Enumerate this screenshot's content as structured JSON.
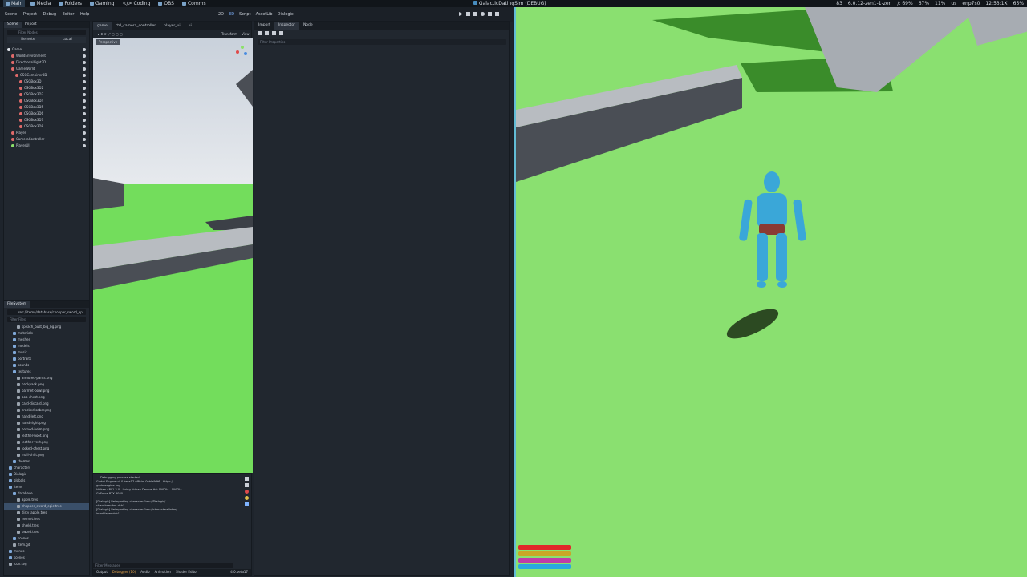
{
  "topbar": {
    "workspaces": [
      {
        "label": "Main",
        "active": true
      },
      {
        "label": "Media"
      },
      {
        "label": "Folders"
      },
      {
        "label": "Gaming"
      },
      {
        "label": "</> Coding"
      },
      {
        "label": "OBS"
      },
      {
        "label": "Comms"
      }
    ],
    "window_title": "GalacticDatingSim (DEBUG)",
    "status": [
      "83",
      "6.0.12-zen1-1-zen",
      "/: 69%",
      "67%",
      "11%",
      "us",
      "enp7s0",
      "12:53:1X",
      "65%"
    ]
  },
  "godot": {
    "menu": [
      "Scene",
      "Project",
      "Debug",
      "Editor",
      "Help"
    ],
    "main_screens": [
      "2D",
      "3D",
      "Script",
      "AssetLib",
      "Dialogic"
    ],
    "scene_dock": {
      "tabs": [
        "Scene",
        "Import"
      ],
      "filter_placeholder": "Filter Nodes",
      "buttons": [
        "Remote",
        "Local"
      ],
      "nodes": [
        {
          "name": "Game",
          "depth": 0,
          "color": "#e0e4ea"
        },
        {
          "name": "WorldEnvironment",
          "depth": 1,
          "color": "#e06a6a"
        },
        {
          "name": "DirectionalLight3D",
          "depth": 1,
          "color": "#e06a6a"
        },
        {
          "name": "GameWorld",
          "depth": 1,
          "color": "#e06a6a"
        },
        {
          "name": "CSGCombiner3D",
          "depth": 2,
          "color": "#e06a6a"
        },
        {
          "name": "CSGBox3D",
          "depth": 3,
          "color": "#e06a6a"
        },
        {
          "name": "CSGBox3D2",
          "depth": 3,
          "color": "#e06a6a"
        },
        {
          "name": "CSGBox3D3",
          "depth": 3,
          "color": "#e06a6a"
        },
        {
          "name": "CSGBox3D4",
          "depth": 3,
          "color": "#e06a6a"
        },
        {
          "name": "CSGBox3D5",
          "depth": 3,
          "color": "#e06a6a"
        },
        {
          "name": "CSGBox3D6",
          "depth": 3,
          "color": "#e06a6a"
        },
        {
          "name": "CSGBox3D7",
          "depth": 3,
          "color": "#e06a6a"
        },
        {
          "name": "CSGBox3D8",
          "depth": 3,
          "color": "#e06a6a"
        },
        {
          "name": "Player",
          "depth": 1,
          "color": "#e06a6a"
        },
        {
          "name": "CameraController",
          "depth": 1,
          "color": "#e06a6a"
        },
        {
          "name": "PlayerUI",
          "depth": 1,
          "color": "#8ce06a"
        }
      ]
    },
    "filesystem": {
      "tab": "FileSystem",
      "path": "res://items/database/chopper_sword_epi...",
      "filter_placeholder": "Filter Files",
      "files": [
        {
          "name": "speach_bust_big_bg.png",
          "depth": 2
        },
        {
          "name": "materials",
          "depth": 1,
          "folder": true
        },
        {
          "name": "meshes",
          "depth": 1,
          "folder": true
        },
        {
          "name": "models",
          "depth": 1,
          "folder": true
        },
        {
          "name": "music",
          "depth": 1,
          "folder": true
        },
        {
          "name": "portraits",
          "depth": 1,
          "folder": true
        },
        {
          "name": "sounds",
          "depth": 1,
          "folder": true
        },
        {
          "name": "textures",
          "depth": 1,
          "folder": true
        },
        {
          "name": "armored-pants.png",
          "depth": 2
        },
        {
          "name": "backpack.png",
          "depth": 2
        },
        {
          "name": "barrnet-bowl.png",
          "depth": 2
        },
        {
          "name": "bob-chest.png",
          "depth": 2
        },
        {
          "name": "card-discard.png",
          "depth": 2
        },
        {
          "name": "cracked-saber.png",
          "depth": 2
        },
        {
          "name": "hand-left.png",
          "depth": 2
        },
        {
          "name": "hand-right.png",
          "depth": 2
        },
        {
          "name": "horned-helm.png",
          "depth": 2
        },
        {
          "name": "leather-boot.png",
          "depth": 2
        },
        {
          "name": "leather-vest.png",
          "depth": 2
        },
        {
          "name": "locked-chest.png",
          "depth": 2
        },
        {
          "name": "mail-shirt.png",
          "depth": 2
        },
        {
          "name": "themes",
          "depth": 1,
          "folder": true
        },
        {
          "name": "characters",
          "depth": 0,
          "folder": true
        },
        {
          "name": "Dialogic",
          "depth": 0,
          "folder": true
        },
        {
          "name": "globals",
          "depth": 0,
          "folder": true
        },
        {
          "name": "items",
          "depth": 0,
          "folder": true
        },
        {
          "name": "database",
          "depth": 1,
          "folder": true
        },
        {
          "name": "apple.tres",
          "depth": 2
        },
        {
          "name": "chopper_sword_epic.tres",
          "depth": 2,
          "selected": true
        },
        {
          "name": "dirty_apple.tres",
          "depth": 2
        },
        {
          "name": "helmet.tres",
          "depth": 2
        },
        {
          "name": "shield.tres",
          "depth": 2
        },
        {
          "name": "sword.tres",
          "depth": 2
        },
        {
          "name": "scenes",
          "depth": 1,
          "folder": true
        },
        {
          "name": "item.gd",
          "depth": 1
        },
        {
          "name": "menus",
          "depth": 0,
          "folder": true
        },
        {
          "name": "scenes",
          "depth": 0,
          "folder": true
        },
        {
          "name": "icon.svg",
          "depth": 0
        }
      ]
    },
    "viewport": {
      "tabs": [
        "game",
        "ctrl_camera_controller",
        "player_ui",
        "ui"
      ],
      "perspective_label": "Perspective",
      "transform_label": "Transform",
      "view_label": "View"
    },
    "console": {
      "text": "--- Debugging process started ---\nGodot Engine v4.0.beta17.official.0ebla9f96 - https://\ngodotengine.org\nVulkan API 1.3.0 - Using Vulkan Device #0: NVIDIA - NVIDIA\nGeForce RTX 3080\n\n[Dialogic] Reimporting character \"res://Dialogic/\nchaosbrendon.dch\"\n[Dialogic] Reimporting character \"res://characters/intro/\nintroPlayer.dch\"",
      "filter_placeholder": "Filter Messages",
      "bottom_tabs": [
        "Output",
        "Debugger (10)",
        "Audio",
        "Animation",
        "Shader Editor"
      ],
      "version": "4.0.beta17"
    },
    "inspector": {
      "tabs": [
        "Import",
        "Inspector",
        "Node"
      ],
      "filter_placeholder": "Filter Properties"
    }
  },
  "hud": {
    "bars": [
      {
        "name": "health",
        "color": "#e0292a",
        "level": 1.0
      },
      {
        "name": "stamina",
        "color": "#c9a627",
        "level": 1.0
      },
      {
        "name": "mana",
        "color": "#c03aa8",
        "level": 1.0
      },
      {
        "name": "shield",
        "color": "#2aa7e0",
        "level": 1.0
      }
    ]
  }
}
